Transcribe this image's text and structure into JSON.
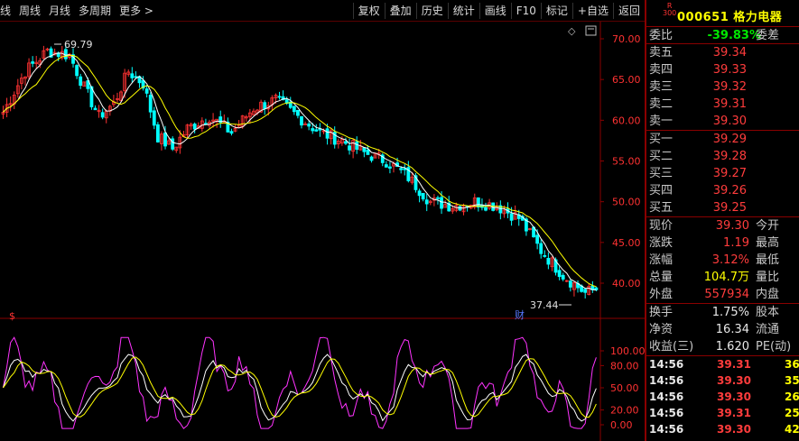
{
  "toolbar": {
    "left": [
      "线",
      "周线",
      "月线",
      "多周期",
      "更多 >"
    ],
    "right": [
      "复权",
      "叠加",
      "历史",
      "统计",
      "画线",
      "F10",
      "标记",
      "+自选",
      "返回"
    ]
  },
  "chart": {
    "price_ticks": [
      "70.00",
      "65.00",
      "60.00",
      "55.00",
      "50.00",
      "45.00",
      "40.00"
    ],
    "osc_ticks": [
      "100.00",
      "80.00",
      "50.00",
      "20.00",
      "0.00"
    ],
    "high_label": "69.79",
    "low_label": "37.44",
    "dollar_marker": "$",
    "cai_marker": "财",
    "colors": {
      "up": "#ff3232",
      "down": "#00ffff",
      "ma_fast": "#ffffff",
      "ma_slow": "#ffff00",
      "osc": "#ff33ff"
    }
  },
  "panel": {
    "badge_r": "R",
    "badge_300": "300",
    "code": "000651 格力电器",
    "weibi": {
      "label": "委比",
      "value": "-39.83%",
      "label2": "委差"
    },
    "asks": [
      {
        "label": "卖五",
        "value": "39.34"
      },
      {
        "label": "卖四",
        "value": "39.33"
      },
      {
        "label": "卖三",
        "value": "39.32"
      },
      {
        "label": "卖二",
        "value": "39.31"
      },
      {
        "label": "卖一",
        "value": "39.30"
      }
    ],
    "bids": [
      {
        "label": "买一",
        "value": "39.29"
      },
      {
        "label": "买二",
        "value": "39.28"
      },
      {
        "label": "买三",
        "value": "39.27"
      },
      {
        "label": "买四",
        "value": "39.26"
      },
      {
        "label": "买五",
        "value": "39.25"
      }
    ],
    "quote": [
      {
        "label": "现价",
        "value": "39.30",
        "label2": "今开",
        "cls": "red"
      },
      {
        "label": "涨跌",
        "value": "1.19",
        "label2": "最高",
        "cls": "red"
      },
      {
        "label": "涨幅",
        "value": "3.12%",
        "label2": "最低",
        "cls": "red"
      },
      {
        "label": "总量",
        "value": "104.7万",
        "label2": "量比",
        "cls": "yellow"
      },
      {
        "label": "外盘",
        "value": "557934",
        "label2": "内盘",
        "cls": "red"
      }
    ],
    "fin": [
      {
        "label": "换手",
        "value": "1.75%",
        "label2": "股本"
      },
      {
        "label": "净资",
        "value": "16.34",
        "label2": "流通"
      },
      {
        "label": "收益(三)",
        "value": "1.620",
        "label2": "PE(动)"
      }
    ],
    "trades": [
      {
        "time": "14:56",
        "price": "39.31",
        "vol": "36"
      },
      {
        "time": "14:56",
        "price": "39.30",
        "vol": "35"
      },
      {
        "time": "14:56",
        "price": "39.30",
        "vol": "26"
      },
      {
        "time": "14:56",
        "price": "39.31",
        "vol": "25"
      },
      {
        "time": "14:56",
        "price": "39.30",
        "vol": "42"
      }
    ]
  }
}
